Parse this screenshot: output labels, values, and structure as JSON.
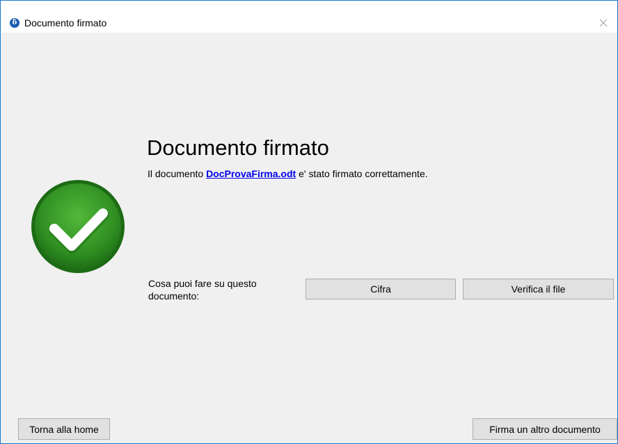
{
  "window": {
    "title": "Documento firmato",
    "app_icon": "dike-app-icon",
    "app_icon_glyph": "δ",
    "close_icon": "close-icon"
  },
  "status": {
    "icon": "success-checkmark-icon",
    "icon_color": "#3c9a2c",
    "title": "Documento firmato",
    "message_prefix": "Il documento ",
    "file_name": "DocProvaFirma.odt",
    "message_suffix": " e' stato firmato correttamente."
  },
  "actions": {
    "label": "Cosa puoi fare su questo documento:",
    "encrypt_label": "Cifra",
    "verify_label": "Verifica il file"
  },
  "footer": {
    "home_label": "Torna alla home",
    "sign_another_label": "Firma un altro documento"
  },
  "colors": {
    "window_border": "#1979ca",
    "background": "#f0f0f0",
    "link": "#0000ee",
    "button_face": "#e1e1e1",
    "button_border": "#adadad"
  }
}
